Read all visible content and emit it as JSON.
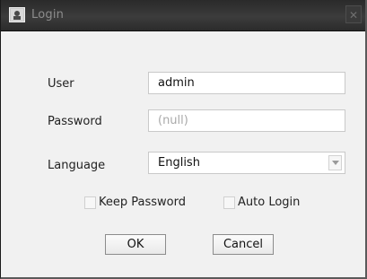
{
  "window": {
    "title": "Login",
    "close_glyph": "✕"
  },
  "form": {
    "user_label": "User",
    "user_value": "admin",
    "password_label": "Password",
    "password_placeholder": "(null)",
    "language_label": "Language",
    "language_value": "English"
  },
  "options": {
    "keep_password_label": "Keep Password",
    "keep_password_checked": false,
    "auto_login_label": "Auto Login",
    "auto_login_checked": false
  },
  "buttons": {
    "ok_label": "OK",
    "cancel_label": "Cancel"
  },
  "icons": [
    "app-icon",
    "close-icon",
    "dropdown-arrow-icon"
  ]
}
